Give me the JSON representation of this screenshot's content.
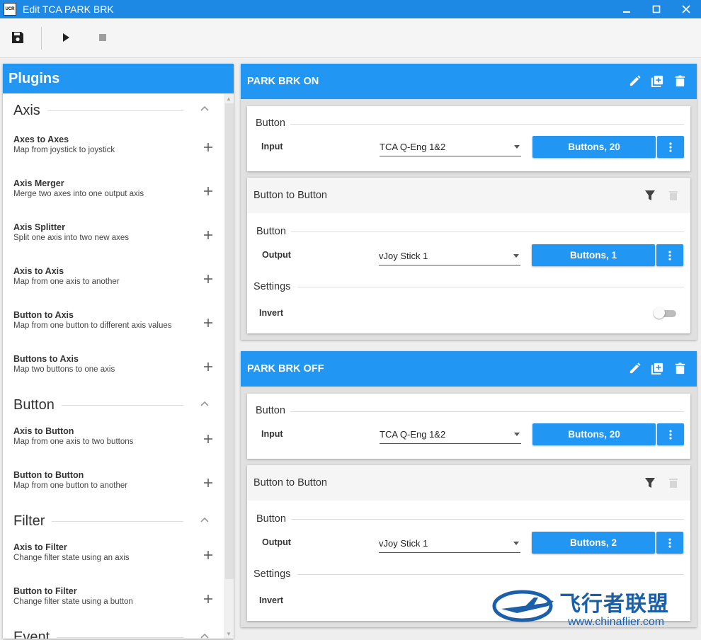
{
  "window": {
    "title": "Edit TCA PARK BRK",
    "icon_text": "UCR"
  },
  "toolbar": {
    "save": "save-icon",
    "play": "play-icon",
    "stop": "stop-icon"
  },
  "plugins": {
    "title": "Plugins",
    "sections": [
      {
        "title": "Axis",
        "items": [
          {
            "name": "Axes to Axes",
            "desc": "Map from joystick to joystick"
          },
          {
            "name": "Axis Merger",
            "desc": "Merge two axes into one output axis"
          },
          {
            "name": "Axis Splitter",
            "desc": "Split one axis into two new axes"
          },
          {
            "name": "Axis to Axis",
            "desc": "Map from one axis to another"
          },
          {
            "name": "Button to Axis",
            "desc": "Map from one button to different axis values"
          },
          {
            "name": "Buttons to Axis",
            "desc": "Map two buttons to one axis"
          }
        ]
      },
      {
        "title": "Button",
        "items": [
          {
            "name": "Axis to Button",
            "desc": "Map from one axis to two buttons"
          },
          {
            "name": "Button to Button",
            "desc": "Map from one button to another"
          }
        ]
      },
      {
        "title": "Filter",
        "items": [
          {
            "name": "Axis to Filter",
            "desc": "Change filter state using an axis"
          },
          {
            "name": "Button to Filter",
            "desc": "Change filter state using a button"
          }
        ]
      },
      {
        "title": "Event",
        "items": []
      }
    ]
  },
  "mappings": [
    {
      "title": "PARK BRK ON",
      "input": {
        "section": "Button",
        "label": "Input",
        "device": "TCA Q-Eng 1&2",
        "button": "Buttons, 20"
      },
      "plugin": {
        "title": "Button to Button",
        "section": "Button",
        "output_label": "Output",
        "device": "vJoy Stick 1",
        "button": "Buttons, 1",
        "settings": "Settings",
        "invert_label": "Invert",
        "invert": false
      }
    },
    {
      "title": "PARK BRK OFF",
      "input": {
        "section": "Button",
        "label": "Input",
        "device": "TCA Q-Eng 1&2",
        "button": "Buttons, 20"
      },
      "plugin": {
        "title": "Button to Button",
        "section": "Button",
        "output_label": "Output",
        "device": "vJoy Stick 1",
        "button": "Buttons, 2",
        "settings": "Settings",
        "invert_label": "Invert"
      }
    }
  ],
  "watermark": {
    "text": "飞行者联盟",
    "url": "www.chinaflier.com"
  },
  "colors": {
    "accent": "#2196f3",
    "titlebar": "#1e88e5"
  }
}
